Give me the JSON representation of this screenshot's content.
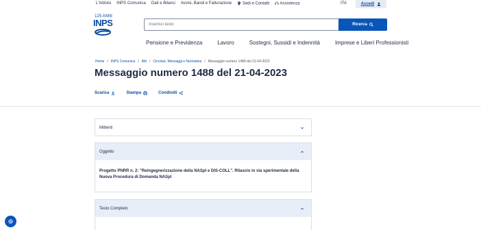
{
  "topbar": {
    "links": [
      "L'Istituto",
      "INPS Comunica",
      "Dati e Bilanci",
      "Avvisi, Bandi e Fatturazione",
      "Sedi e Contatti",
      "Assistenza"
    ],
    "lang": "ITA",
    "login": "Accedi"
  },
  "logo": {
    "anni": "125 ANNI",
    "brand": "INPS"
  },
  "search": {
    "placeholder": "Inserisci testo",
    "button": "Ricerca"
  },
  "nav": [
    "Pensione e Previdenza",
    "Lavoro",
    "Sostegni, Sussidi e Indennità",
    "Imprese e Liberi Professionisti"
  ],
  "breadcrumb": [
    "Home",
    "INPS Comunica",
    "Atti",
    "Circolari, Messaggi e Normativa",
    "Messaggio numero 1488 del 21-04-2023"
  ],
  "page": {
    "title": "Messaggio numero 1488 del 21-04-2023"
  },
  "actions": {
    "download": "Scarica",
    "print": "Stampa",
    "share": "Condividi"
  },
  "accordions": {
    "mittenti": {
      "label": "Mittenti"
    },
    "oggetto": {
      "label": "Oggetto",
      "body": "Progetto PNRR n. 2: \"Reingegnerizzazione della NASpI e DIS-COLL\". Rilascio in via sperimentale della Nuova Procedura di Domanda NASpI"
    },
    "testo": {
      "label": "Testo Completo"
    }
  },
  "colors": {
    "primary": "#0a55b8",
    "text": "#1d2a44",
    "panel": "#e7eef8"
  }
}
